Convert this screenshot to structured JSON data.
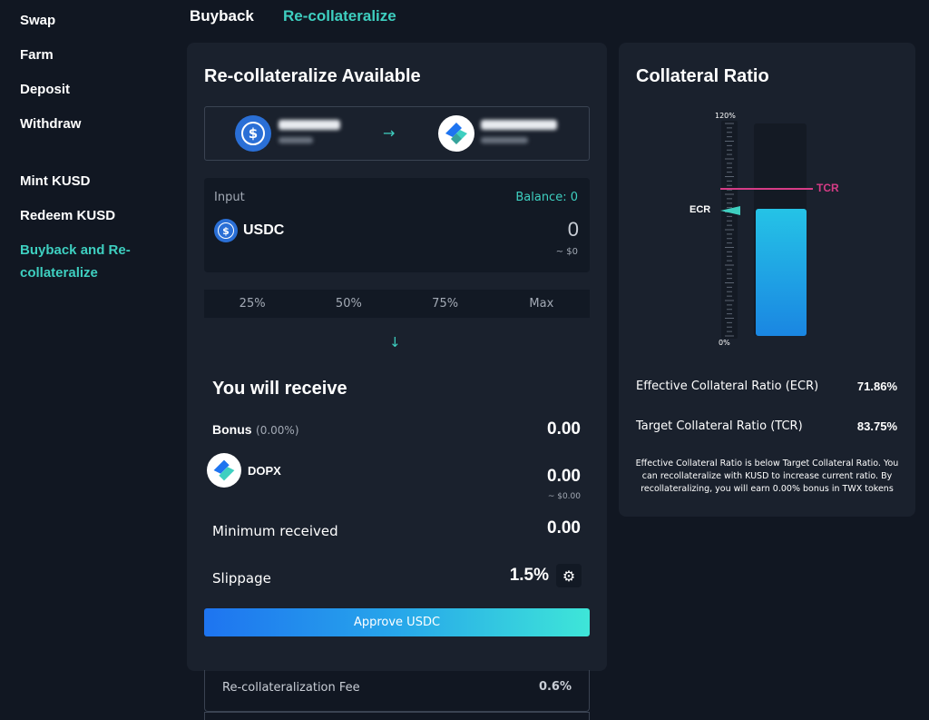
{
  "sidebar": {
    "items": [
      {
        "label": "Swap"
      },
      {
        "label": "Farm"
      },
      {
        "label": "Deposit"
      },
      {
        "label": "Withdraw"
      },
      {
        "label": "Mint KUSD"
      },
      {
        "label": "Redeem KUSD"
      },
      {
        "label": "Buyback and Re-collateralize"
      }
    ],
    "active_line1": "Buyback and Re-",
    "active_line2": "collateralize"
  },
  "tabs": {
    "buyback": "Buyback",
    "recollateralize": "Re-collateralize"
  },
  "main": {
    "title": "Re-collateralize Available",
    "input": {
      "label": "Input",
      "balance": "Balance: 0",
      "token": "USDC",
      "value": "0",
      "usd": "~ $0"
    },
    "percent_buttons": [
      "25%",
      "50%",
      "75%",
      "Max"
    ],
    "receive_title": "You will receive",
    "bonus_label": "Bonus",
    "bonus_pct": "(0.00%)",
    "bonus_value": "0.00",
    "receive_token": "DOPX",
    "receive_value": "0.00",
    "receive_usd": "~ $0.00",
    "min_received_label": "Minimum received",
    "min_received_value": "0.00",
    "slippage_label": "Slippage",
    "slippage_value": "1.5%",
    "approve_label": "Approve USDC",
    "fee_label": "Re-collateralization Fee",
    "fee_value": "0.6%"
  },
  "ratio": {
    "title": "Collateral Ratio",
    "gauge_top": "120%",
    "gauge_bottom": "0%",
    "gauge_max_pct": 120,
    "ecr_pct": 71.86,
    "tcr_pct": 83.75,
    "ecr_short": "ECR",
    "tcr_short": "TCR",
    "ecr_label": "Effective Collateral Ratio (ECR)",
    "ecr_value": "71.86%",
    "tcr_label": "Target Collateral Ratio (TCR)",
    "tcr_value": "83.75%",
    "note": "Effective Collateral Ratio is below Target Collateral Ratio. You can recollateralize with KUSD to increase current ratio. By recollateralizing, you will earn 0.00% bonus in TWX tokens"
  },
  "colors": {
    "accent": "#3ecfc0",
    "tcr": "#d63c86",
    "background": "#111722",
    "panel": "#1a212d"
  }
}
